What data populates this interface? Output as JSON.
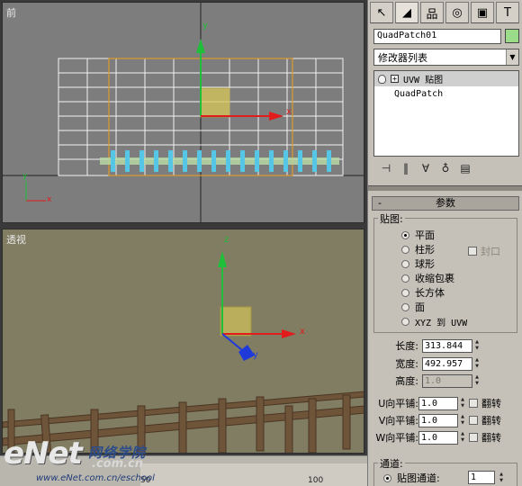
{
  "viewports": {
    "front_label": "前",
    "perspective_label": "透视",
    "axes": {
      "x": "x",
      "y": "y",
      "z": "z"
    }
  },
  "timeline": {
    "ticks": [
      "50",
      "100"
    ]
  },
  "watermark": {
    "brand": "eNet",
    "cn": "网络学院",
    "domain": ".com.cn",
    "url": "www.eNet.com.cn/eschool"
  },
  "panel": {
    "tabs": [
      {
        "icon": "create-icon",
        "glyph": "↖"
      },
      {
        "icon": "modify-icon",
        "glyph": "◢"
      },
      {
        "icon": "hierarchy-icon",
        "glyph": "品"
      },
      {
        "icon": "motion-icon",
        "glyph": "◎"
      },
      {
        "icon": "display-icon",
        "glyph": "▣"
      },
      {
        "icon": "utilities-icon",
        "glyph": "T"
      }
    ],
    "object_name": "QuadPatch01",
    "object_color": "#9bdc8a",
    "modifier_list": "修改器列表",
    "stack": {
      "modifier": "UVW 贴图",
      "base": "QuadPatch"
    },
    "rollout_title": "参数",
    "mapping": {
      "title": "贴图:",
      "options": [
        "平面",
        "柱形",
        "球形",
        "收缩包裹",
        "长方体",
        "面",
        "XYZ 到 UVW"
      ],
      "selected": "平面",
      "cap_label": "封口"
    },
    "dims": {
      "length_label": "长度:",
      "length": "313.844",
      "width_label": "宽度:",
      "width": "492.957",
      "height_label": "高度:",
      "height": "1.0"
    },
    "tiles": [
      {
        "label": "U向平铺:",
        "value": "1.0",
        "flip": "翻转"
      },
      {
        "label": "V向平铺:",
        "value": "1.0",
        "flip": "翻转"
      },
      {
        "label": "W向平铺:",
        "value": "1.0",
        "flip": "翻转"
      }
    ],
    "channel": {
      "title": "通道:",
      "option": "贴图通道:",
      "value": "1"
    }
  }
}
